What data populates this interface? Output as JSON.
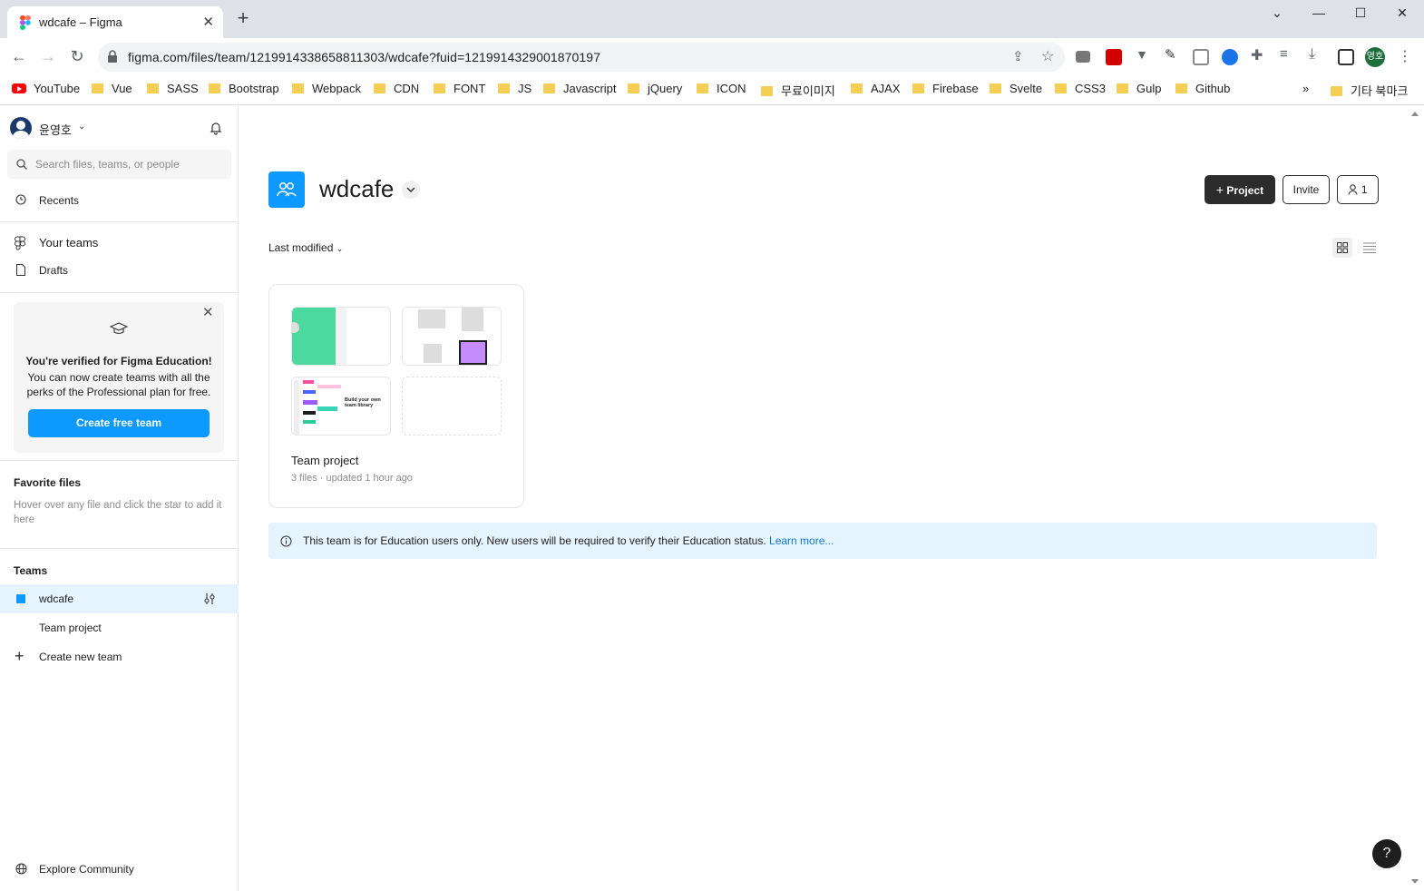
{
  "browser": {
    "tab_title": "wdcafe – Figma",
    "url": "figma.com/files/team/1219914338658811303/wdcafe?fuid=1219914329001870197",
    "profile_initials": "영호",
    "bookmarks": [
      "YouTube",
      "Vue",
      "SASS",
      "Bootstrap",
      "Webpack",
      "CDN",
      "FONT",
      "JS",
      "Javascript",
      "jQuery",
      "ICON",
      "무료이미지",
      "AJAX",
      "Firebase",
      "Svelte",
      "CSS3",
      "Gulp",
      "Github"
    ],
    "other_bookmarks": "기타 북마크",
    "more": "»"
  },
  "sidebar": {
    "user_name": "윤영호",
    "search_placeholder": "Search files, teams, or people",
    "recents": "Recents",
    "your_teams": "Your teams",
    "drafts": "Drafts",
    "edu_card": {
      "heading": "You're verified for Figma Education!",
      "body": "You can now create teams with all the perks of the Professional plan for free.",
      "button": "Create free team"
    },
    "favorites_title": "Favorite files",
    "favorites_hint": "Hover over any file and click the star to add it here",
    "teams_title": "Teams",
    "team_name": "wdcafe",
    "team_project": "Team project",
    "create_team": "Create new team",
    "explore": "Explore Community"
  },
  "main": {
    "team_name": "wdcafe",
    "buttons": {
      "project": "Project",
      "invite": "Invite",
      "members_count": "1"
    },
    "sort_label": "Last modified",
    "project": {
      "title": "Team project",
      "meta": "3 files · updated 1 hour ago",
      "thumb_text": "Build your own team library"
    },
    "banner": {
      "message": "This team is for Education users only. New users will be required to verify their Education status.",
      "link": "Learn more..."
    },
    "help": "?"
  },
  "colors": {
    "accent": "#0d99ff",
    "dark": "#2c2c2c",
    "banner_bg": "#e5f4ff"
  }
}
